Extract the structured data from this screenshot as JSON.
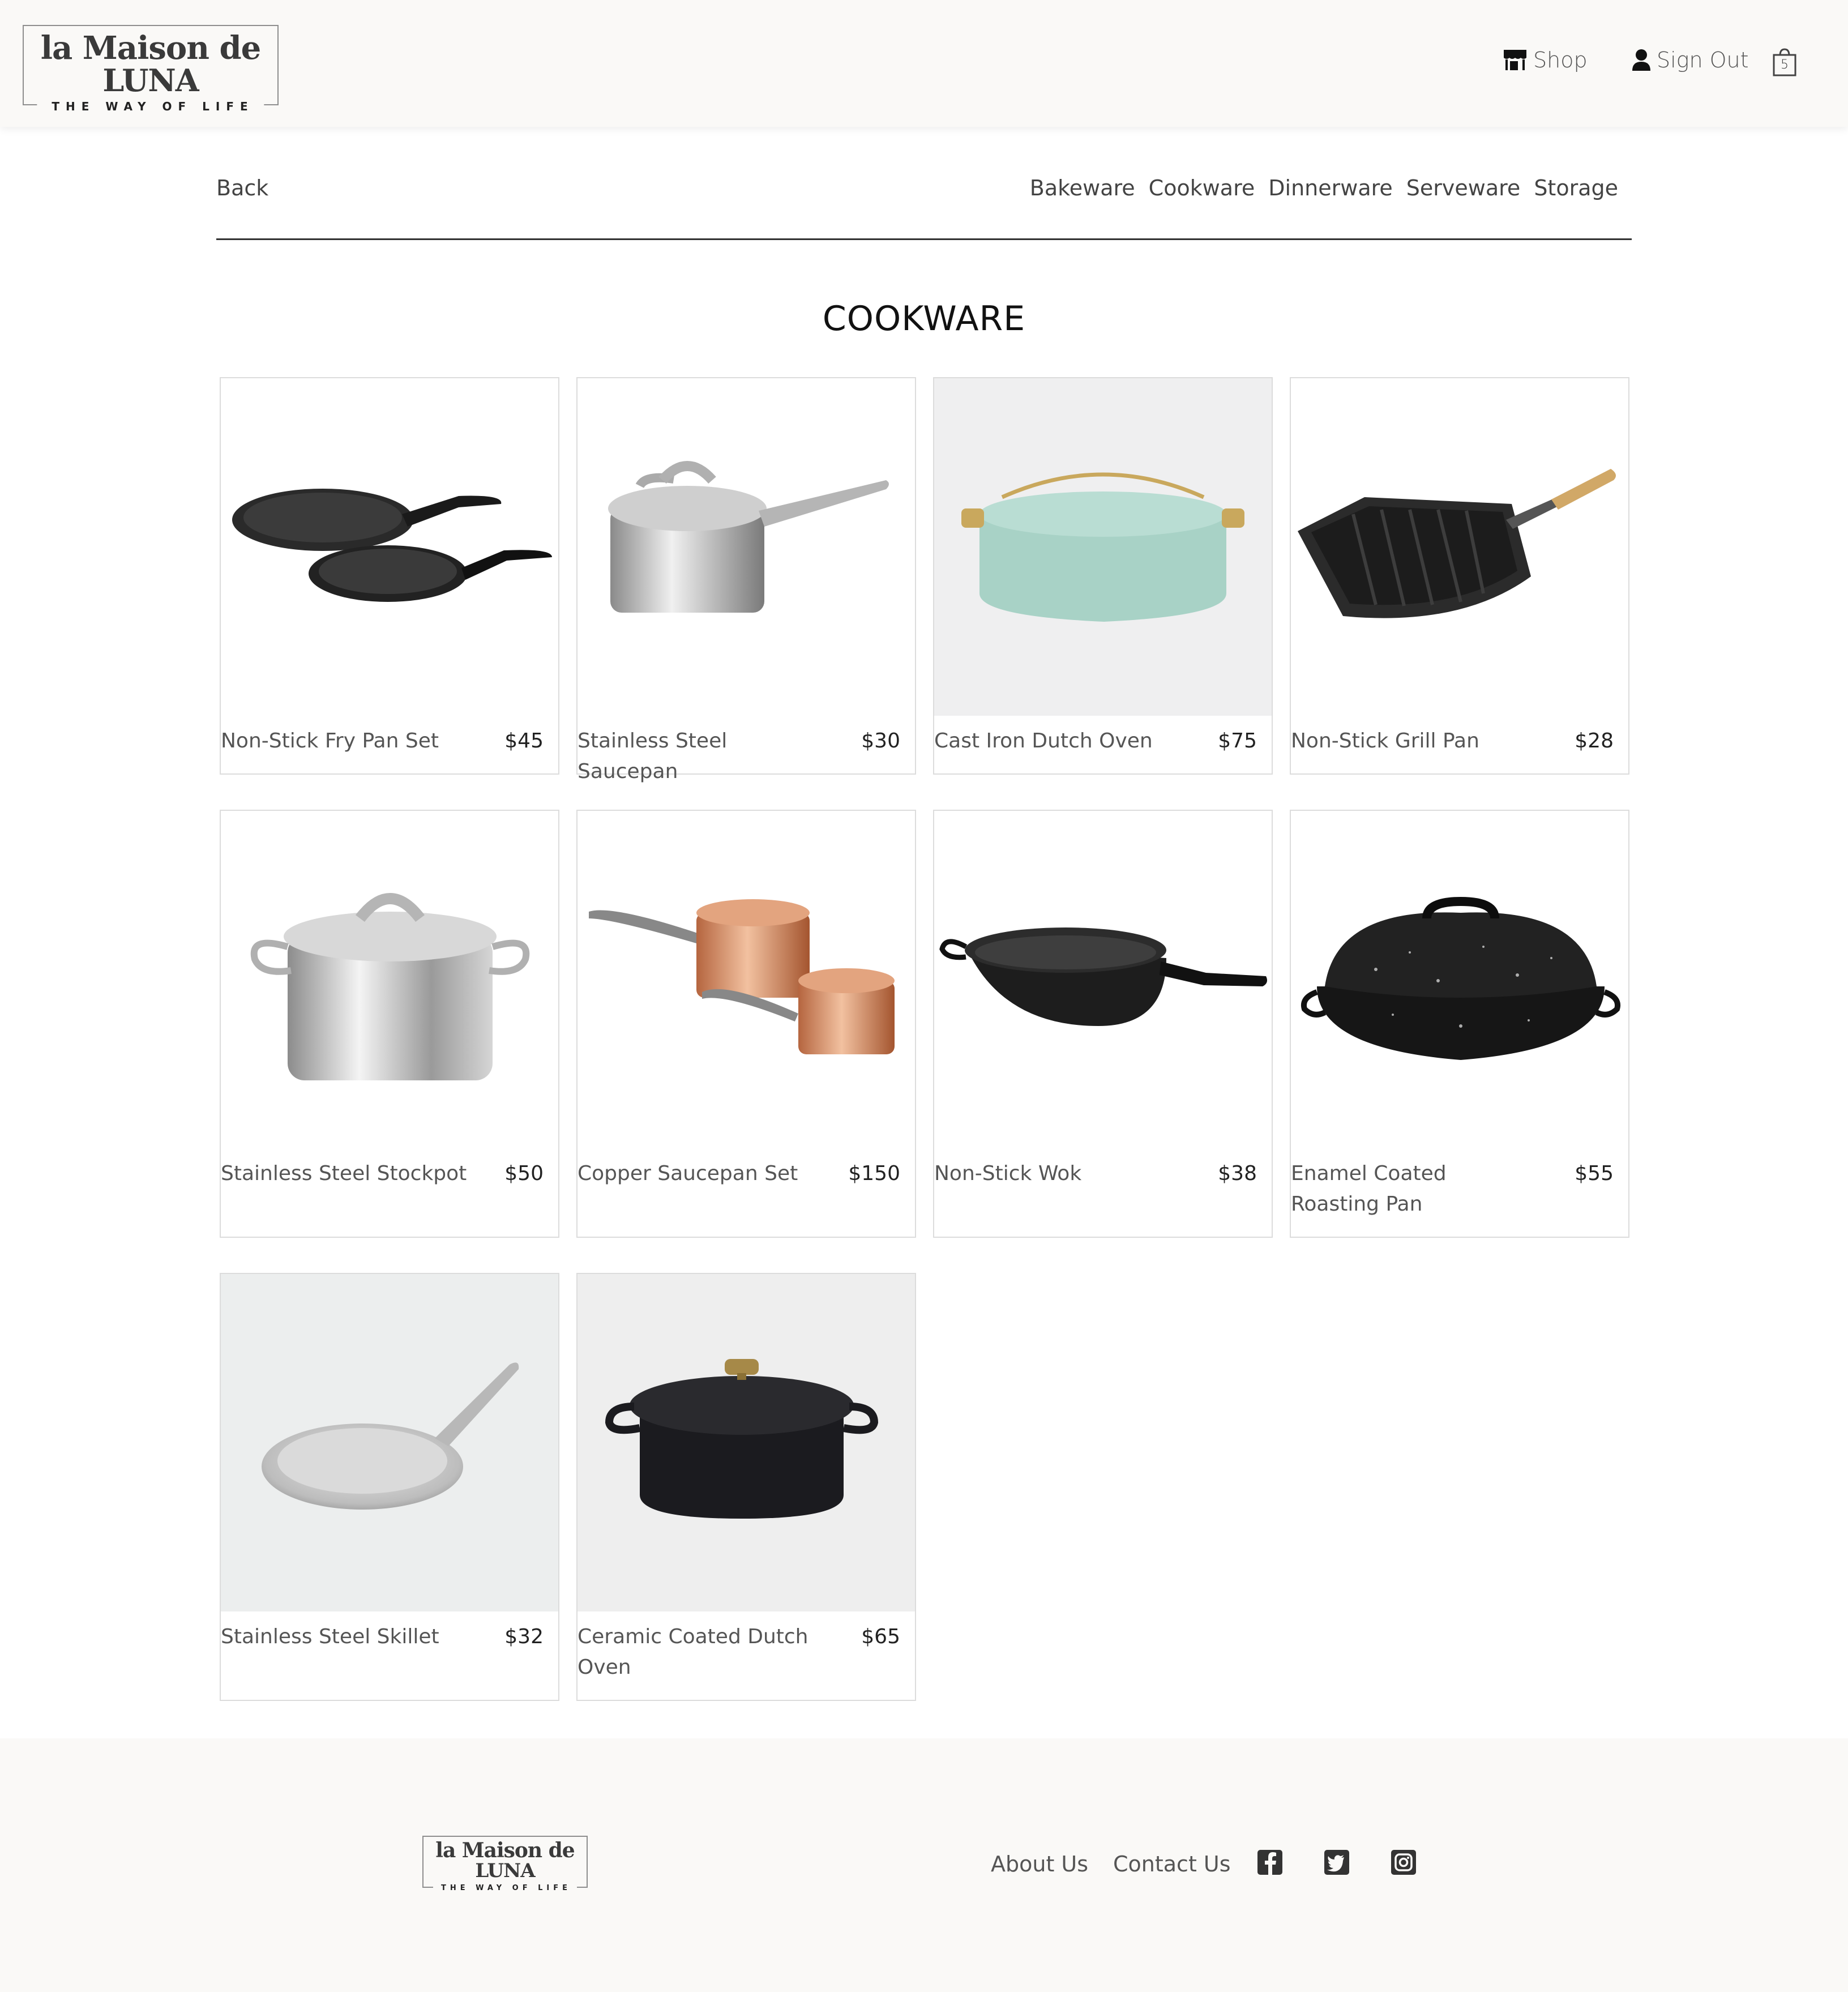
{
  "brand": {
    "line1": "la Maison de",
    "line2": "LUNA",
    "tagline": "THE WAY OF LIFE"
  },
  "header": {
    "shop_label": "Shop",
    "signout_label": "Sign Out",
    "cart_count": "5"
  },
  "subnav": {
    "back_label": "Back",
    "categories": [
      "Bakeware",
      "Cookware",
      "Dinnerware",
      "Serveware",
      "Storage"
    ]
  },
  "page": {
    "title": "COOKWARE"
  },
  "products": [
    {
      "name": "Non-Stick Fry Pan Set",
      "price": "$45",
      "icon": "fry-pan-set-image"
    },
    {
      "name": "Stainless Steel Saucepan",
      "price": "$30",
      "icon": "saucepan-image"
    },
    {
      "name": "Cast Iron Dutch Oven",
      "price": "$75",
      "icon": "dutch-oven-image"
    },
    {
      "name": "Non-Stick Grill Pan",
      "price": "$28",
      "icon": "grill-pan-image"
    },
    {
      "name": "Stainless Steel Stockpot",
      "price": "$50",
      "icon": "stockpot-image"
    },
    {
      "name": "Copper Saucepan Set",
      "price": "$150",
      "icon": "copper-saucepan-image"
    },
    {
      "name": "Non-Stick Wok",
      "price": "$38",
      "icon": "wok-image"
    },
    {
      "name": "Enamel Coated Roasting Pan",
      "price": "$55",
      "icon": "roasting-pan-image"
    },
    {
      "name": "Stainless Steel Skillet",
      "price": "$32",
      "icon": "skillet-image"
    },
    {
      "name": "Ceramic Coated Dutch Oven",
      "price": "$65",
      "icon": "ceramic-dutch-oven-image"
    }
  ],
  "footer": {
    "about_label": "About Us",
    "contact_label": "Contact Us",
    "social": [
      "facebook-icon",
      "twitter-icon",
      "instagram-icon"
    ]
  }
}
